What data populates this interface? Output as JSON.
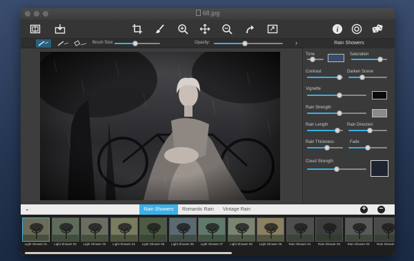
{
  "window": {
    "title": "68.jpg"
  },
  "toolbar": {
    "left_icons": [
      "compare-icon",
      "save-icon"
    ],
    "center_icons": [
      "crop-icon",
      "brush-icon",
      "zoom-in-icon",
      "move-icon",
      "zoom-out-icon",
      "redo-icon",
      "fit-screen-icon"
    ],
    "right_icons": [
      "info-icon",
      "settings-icon",
      "random-dice-icon"
    ]
  },
  "brushbar": {
    "brush_size_label": "Brush Size:",
    "opacity_label": "Opacity:",
    "brush_size_value": 0.45,
    "opacity_value": 0.45
  },
  "panel": {
    "title": "Rain Showers",
    "tone_label": "Tone",
    "saturation_label": "Saturation",
    "contrast_label": "Contrast",
    "darken_scene_label": "Darken Scene",
    "vignette_label": "Vignette",
    "rain_strength_label": "Rain Strength",
    "rain_length_label": "Rain Length",
    "rain_direction_label": "Rain Direction",
    "rain_thickness_label": "Rain Thickness",
    "fade_label": "Fade",
    "cloud_strength_label": "Cloud Strength",
    "tone_color": "#3a4a6a",
    "vignette_color": "#0a0a0a",
    "rain_strength_color": "#8a8a8a",
    "cloud_strength_color": "#1e2530",
    "tone_value": 0.35,
    "saturation_value": 0.8,
    "contrast_value": 0.9,
    "darken_scene_value": 0.35,
    "vignette_value": 0.55,
    "rain_strength_value": 0.55,
    "rain_length_value": 0.85,
    "rain_direction_value": 0.55,
    "rain_thickness_value": 0.55,
    "fade_value": 0.5,
    "cloud_strength_value": 0.5
  },
  "presets": {
    "tabs": [
      "Rain Showers",
      "Romantic Rain",
      "Vintage Rain"
    ],
    "active_tab": 0,
    "add_label": "+",
    "remove_label": "−",
    "thumbnails": [
      "Light Shower 01",
      "Light Shower 02",
      "Light Shower 03",
      "Light Shower 04",
      "Light Shower 05",
      "Light Shower 06",
      "Light Shower 07",
      "Light Shower 08",
      "Light Shower 09",
      "Rain Shower 01",
      "Rain Shower 02",
      "Rain Shower 03",
      "Rain Shower 04"
    ],
    "thumbnail_tints": [
      "#6b6b58",
      "#5e6a5a",
      "#6a6e60",
      "#7a7c60",
      "#4d5a44",
      "#5a6a72",
      "#5f7a6a",
      "#7a8470",
      "#8a8062",
      "#4e4e4e",
      "#3e3e3e",
      "#5a5a5a",
      "#4a4a4a"
    ]
  }
}
